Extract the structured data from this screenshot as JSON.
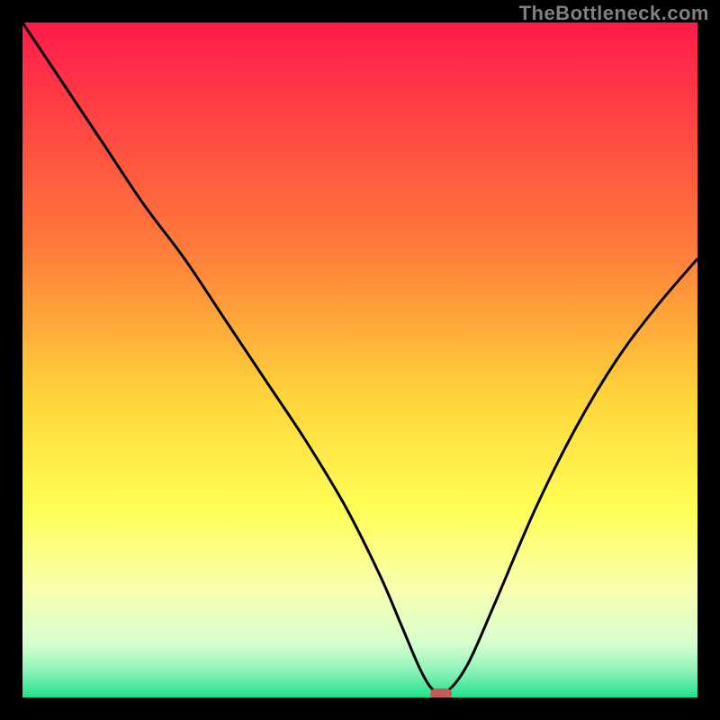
{
  "watermark": "TheBottleneck.com",
  "colors": {
    "frame": "#000000",
    "watermark": "#808080",
    "curve": "#000000",
    "datum": "#c75a59",
    "gradient_stops": [
      {
        "pct": 0,
        "color": "#ff1a4b"
      },
      {
        "pct": 33,
        "color": "#ff7a3a"
      },
      {
        "pct": 55,
        "color": "#ffd33a"
      },
      {
        "pct": 72,
        "color": "#ffff55"
      },
      {
        "pct": 84,
        "color": "#f8ffb0"
      },
      {
        "pct": 92,
        "color": "#d7ffcf"
      },
      {
        "pct": 96,
        "color": "#8ff2ba"
      },
      {
        "pct": 100,
        "color": "#1fe28a"
      }
    ]
  },
  "chart_data": {
    "type": "line",
    "title": "",
    "xlabel": "",
    "ylabel": "",
    "xlim": [
      0,
      100
    ],
    "ylim": [
      0,
      100
    ],
    "series": [
      {
        "name": "bottleneck-curve",
        "x": [
          0,
          6,
          12,
          18,
          24,
          30,
          36,
          42,
          48,
          53,
          56,
          59,
          61,
          63,
          66,
          70,
          76,
          82,
          88,
          94,
          100
        ],
        "values": [
          100,
          91,
          82,
          73,
          65,
          56,
          47,
          38,
          28,
          18,
          11,
          4,
          1,
          1,
          5,
          14,
          28,
          40,
          50,
          58,
          65
        ]
      }
    ],
    "datum_point": {
      "x": 62,
      "y": 0.5,
      "name": "optimal-point"
    }
  }
}
